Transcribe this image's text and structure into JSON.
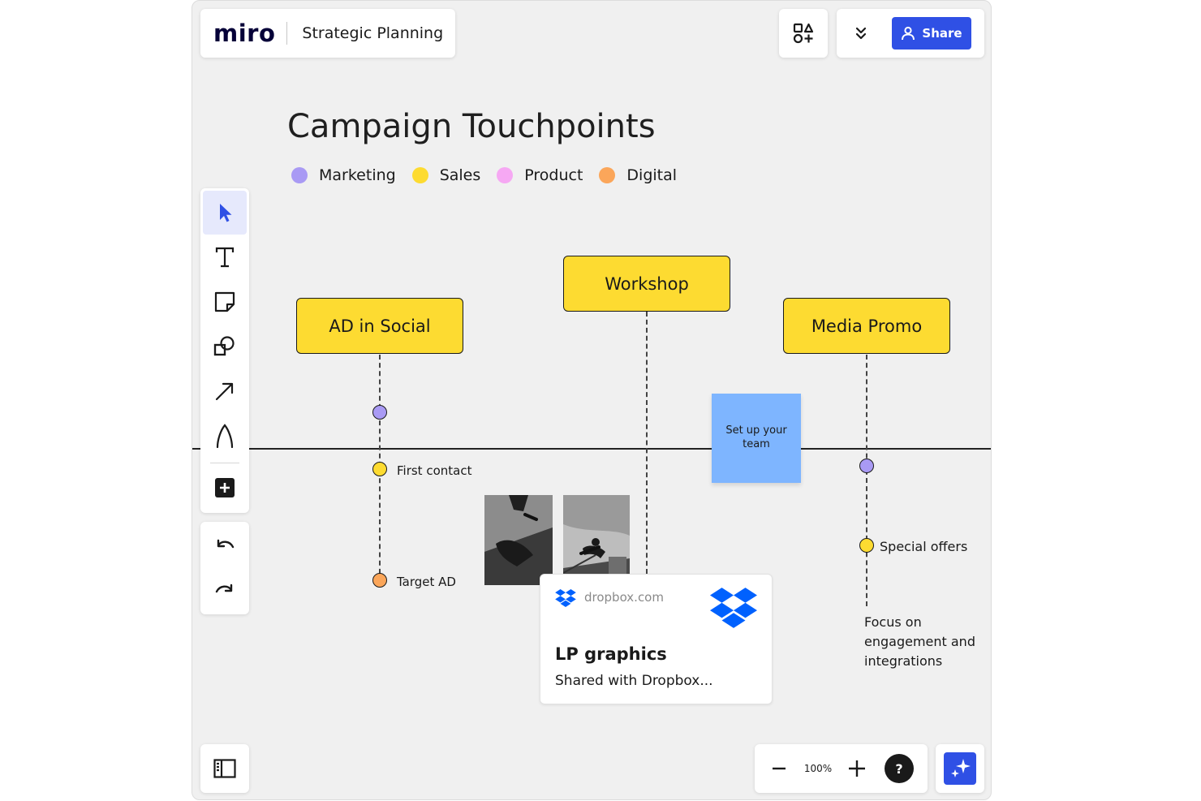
{
  "header": {
    "logo": "miro",
    "board_name": "Strategic Planning",
    "share_label": "Share"
  },
  "board": {
    "title": "Campaign Touchpoints",
    "legend": [
      {
        "label": "Marketing",
        "color": "#a99af4"
      },
      {
        "label": "Sales",
        "color": "#fddb31"
      },
      {
        "label": "Product",
        "color": "#f6a8f3"
      },
      {
        "label": "Digital",
        "color": "#fba65a"
      }
    ],
    "cards": {
      "ad_in_social": "AD in Social",
      "workshop": "Workshop",
      "media_promo": "Media Promo"
    },
    "labels": {
      "first_contact": "First contact",
      "target_ad": "Target AD",
      "special_offers": "Special offers"
    },
    "sticky_note": "Set up your team",
    "link_card": {
      "domain": "dropbox.com",
      "title": "LP graphics",
      "subtitle": "Shared with Dropbox..."
    },
    "note_text": "Focus on engagement and integrations"
  },
  "toolbar": {
    "tools": [
      "select-tool",
      "text-tool",
      "sticky-note-tool",
      "shapes-tool",
      "connection-line-tool",
      "pen-tool",
      "more-apps-tool"
    ],
    "active": "select-tool"
  },
  "zoom": {
    "level": "100%",
    "help_label": "?"
  },
  "colors": {
    "accent": "#2f50e5",
    "card_yellow": "#fddb31",
    "sticky_blue": "#7eb5ff",
    "canvas": "#f0f0f0"
  }
}
